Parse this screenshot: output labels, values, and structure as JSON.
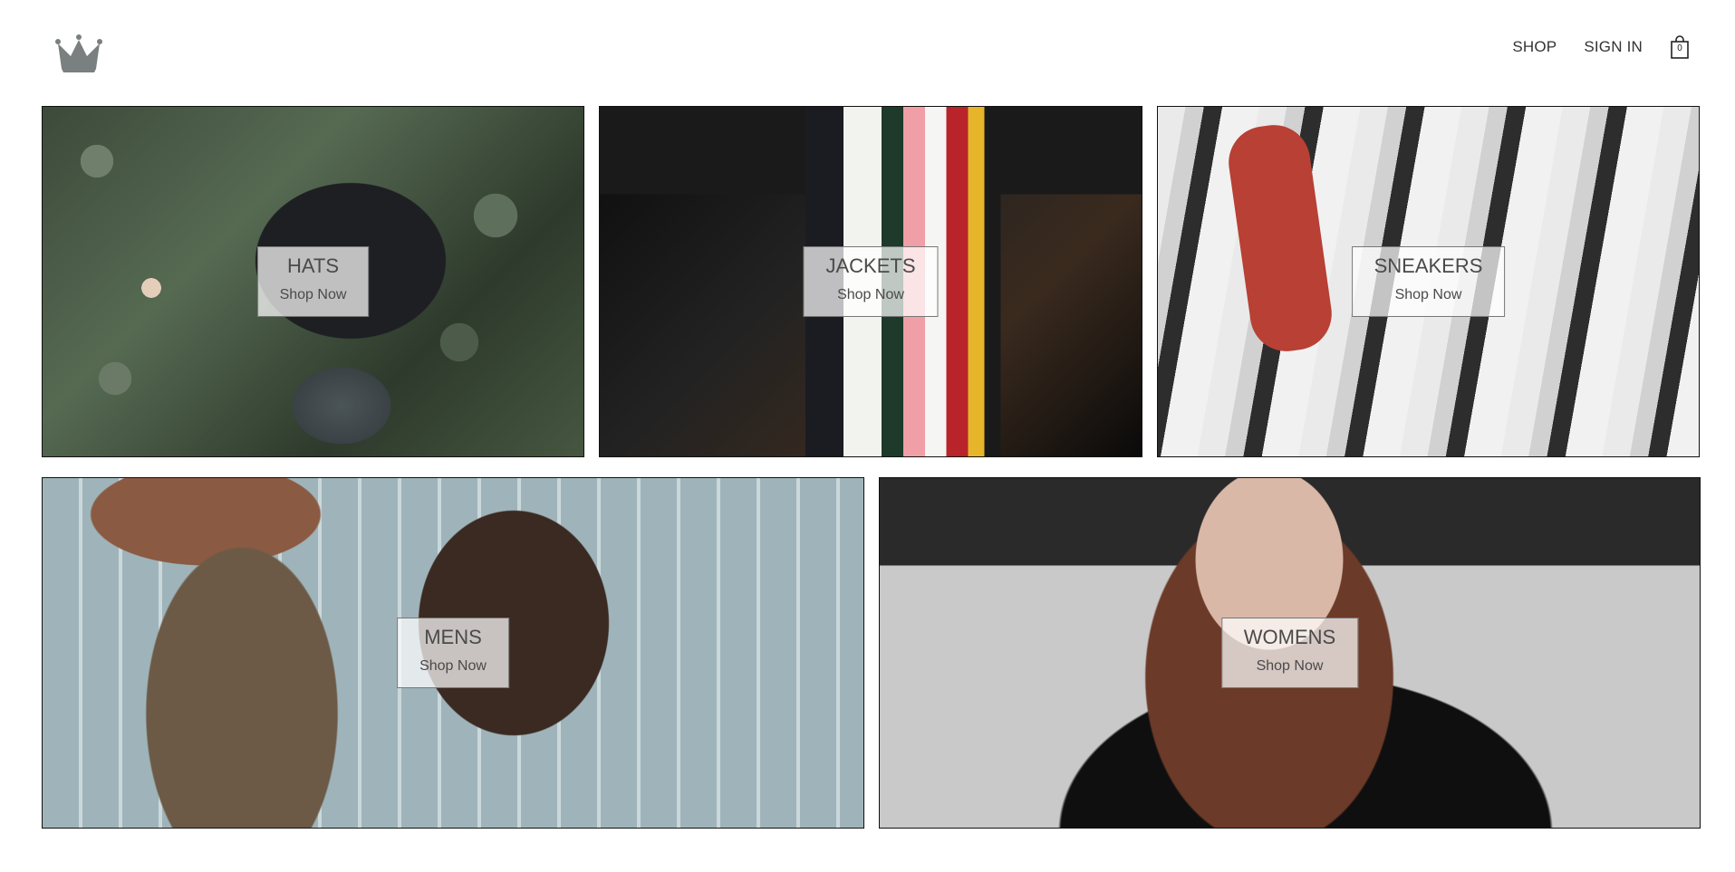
{
  "header": {
    "logo_icon": "crown-icon",
    "nav": {
      "shop_label": "SHOP",
      "sign_in_label": "SIGN IN",
      "cart_icon": "shopping-bag-icon",
      "cart_count": "0"
    }
  },
  "categories": [
    {
      "title": "HATS",
      "cta": "Shop Now"
    },
    {
      "title": "JACKETS",
      "cta": "Shop Now"
    },
    {
      "title": "SNEAKERS",
      "cta": "Shop Now"
    },
    {
      "title": "MENS",
      "cta": "Shop Now"
    },
    {
      "title": "WOMENS",
      "cta": "Shop Now"
    }
  ]
}
